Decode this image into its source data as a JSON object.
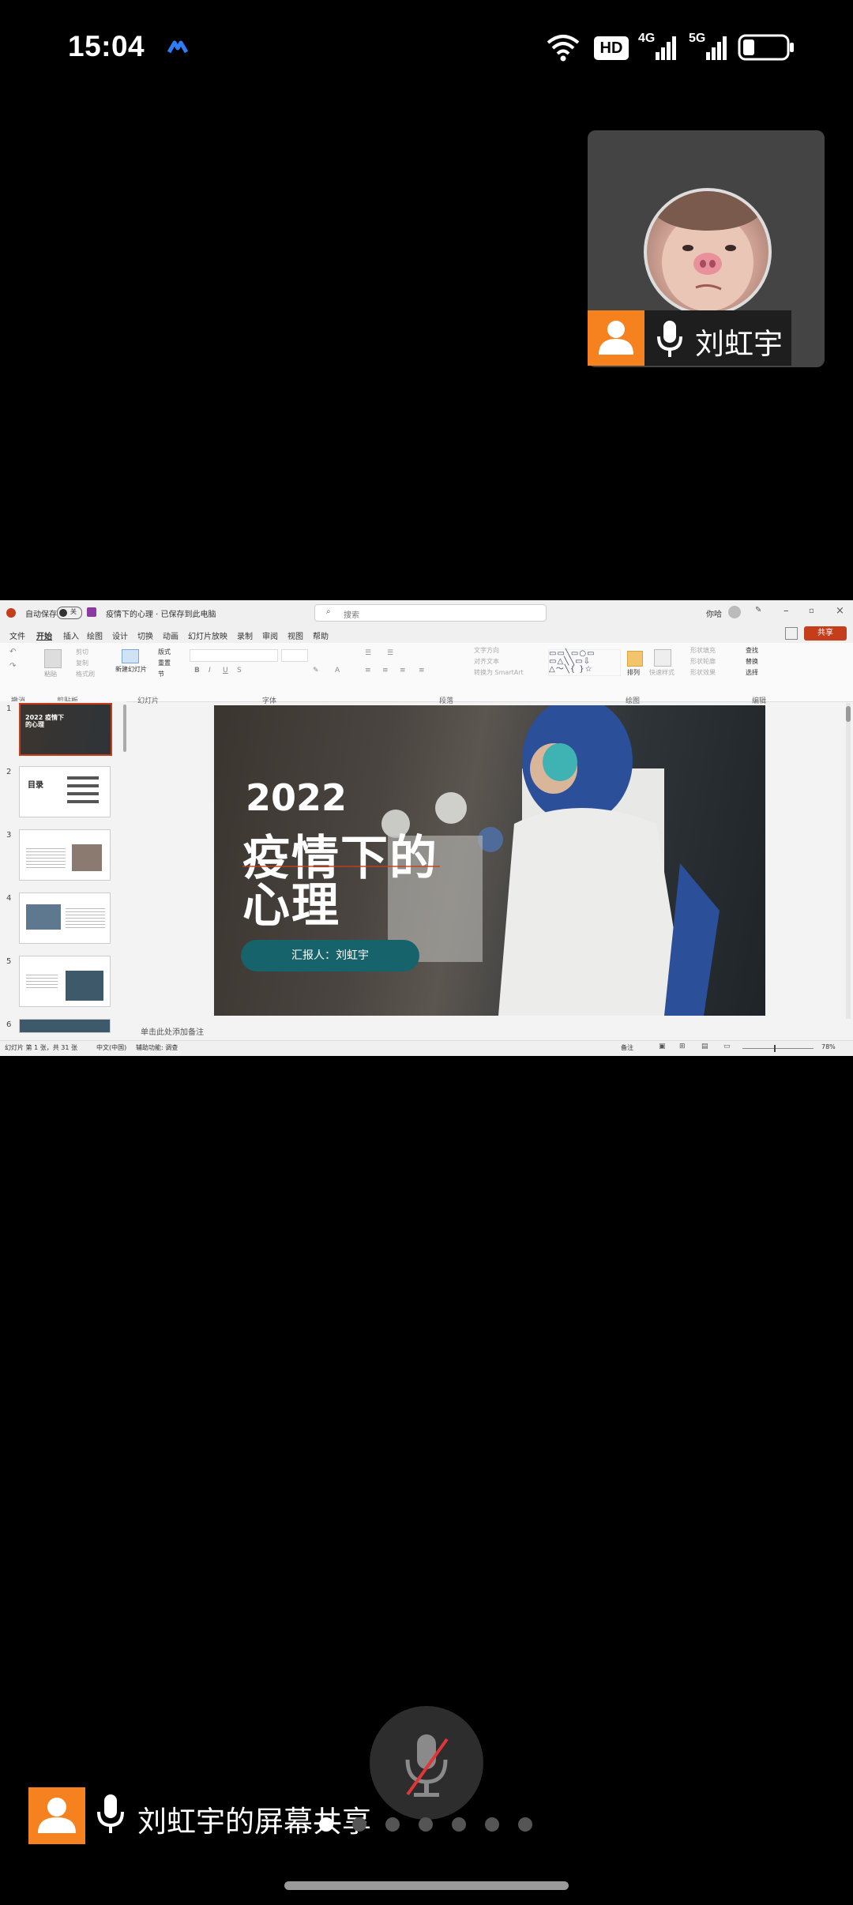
{
  "status_bar": {
    "time": "15:04",
    "indicators": [
      "wifi-icon",
      "hd-icon",
      "4g-signal-icon",
      "5g-signal-icon",
      "battery-icon"
    ],
    "hd_label": "HD",
    "net1": "4G",
    "net2": "5G"
  },
  "participant": {
    "name": "刘虹宇"
  },
  "ppt": {
    "autosave": "自动保存",
    "autosave_state": "关",
    "doc_title": "疫情下的心理 · 已保存到此电脑",
    "search_placeholder": "搜索",
    "user": "你哈",
    "menu": [
      "文件",
      "开始",
      "插入",
      "绘图",
      "设计",
      "切换",
      "动画",
      "幻灯片放映",
      "录制",
      "审阅",
      "视图",
      "帮助"
    ],
    "share_label": "共享",
    "ribbon_groups": [
      "撤消",
      "剪贴板",
      "幻灯片",
      "字体",
      "段落",
      "绘图",
      "编辑"
    ],
    "ribbon_buttons": {
      "paste": "粘贴",
      "cut": "剪切",
      "copy": "复制",
      "format_painter": "格式刷",
      "new_slide": "新建幻灯片",
      "layout": "版式",
      "reset": "重置",
      "section": "节",
      "text_direction": "文字方向",
      "align_text": "对齐文本",
      "convert_smartart": "转换为 SmartArt",
      "arrange": "排列",
      "quick_styles": "快速样式",
      "shape_fill": "形状填充",
      "shape_outline": "形状轮廓",
      "shape_effects": "形状效果",
      "find": "查找",
      "replace": "替换",
      "select": "选择"
    },
    "thumbnails": [
      {
        "num": "1",
        "title": "2022 疫情下的心理"
      },
      {
        "num": "2",
        "title": "目录"
      },
      {
        "num": "3",
        "title": ""
      },
      {
        "num": "4",
        "title": ""
      },
      {
        "num": "5",
        "title": ""
      },
      {
        "num": "6",
        "title": ""
      }
    ],
    "slide": {
      "year": "2022",
      "title_line1": "疫情下的",
      "title_line2": "心理",
      "presenter": "汇报人：刘虹宇"
    },
    "notes_placeholder": "单击此处添加备注",
    "status_left": "幻灯片 第 1 张，共 31 张",
    "status_lang": "中文(中国)",
    "status_accessibility": "辅助功能: 调查",
    "status_notes": "备注",
    "zoom": "78%"
  },
  "share": {
    "label": "刘虹宇的屏幕共享",
    "page_dots": 7,
    "active_dot": 0
  },
  "colors": {
    "accent_orange": "#f5821f",
    "slide_button": "#17636b",
    "share_button": "#c43e1c"
  }
}
